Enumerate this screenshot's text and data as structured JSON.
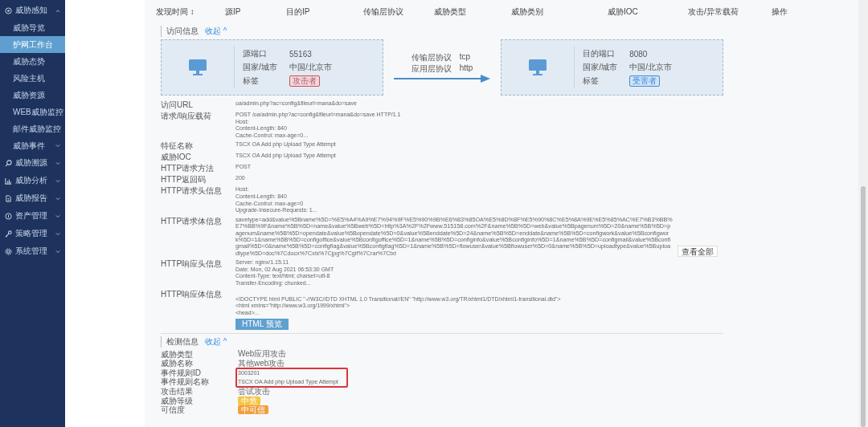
{
  "sidebar": {
    "items": [
      {
        "label": "威胁感知",
        "expanded": true,
        "children": [
          {
            "label": "威胁导览",
            "selected": false
          },
          {
            "label": "护网工作台",
            "selected": true
          },
          {
            "label": "威胁态势",
            "selected": false
          },
          {
            "label": "风险主机",
            "selected": false
          },
          {
            "label": "威胁资源",
            "selected": false
          },
          {
            "label": "WEB威胁监控",
            "selected": false
          },
          {
            "label": "邮件威胁监控",
            "selected": false
          },
          {
            "label": "威胁事件",
            "selected": false,
            "expanded": false
          }
        ]
      },
      {
        "label": "威胁溯源",
        "expanded": false
      },
      {
        "label": "威胁分析",
        "expanded": false
      },
      {
        "label": "威胁报告",
        "expanded": false
      },
      {
        "label": "资产管理",
        "expanded": false
      },
      {
        "label": "策略管理",
        "expanded": false
      },
      {
        "label": "系统管理",
        "expanded": false
      }
    ]
  },
  "table": {
    "columns": [
      "发现时间 ↕",
      "源IP",
      "目的IP",
      "传输层协议",
      "威胁类型",
      "威胁类别",
      "威胁IOC",
      "攻击/异常载荷",
      "操作"
    ]
  },
  "access_info": {
    "title": "访问信息",
    "toggle": "收起 ^",
    "source": {
      "fields": [
        {
          "label": "源端口",
          "value": "55163"
        },
        {
          "label": "国家/城市",
          "value": "中国/北京市"
        }
      ],
      "tag_label": "标签",
      "tag": {
        "text": "攻击者",
        "color": "#e0484a"
      }
    },
    "protocols": [
      {
        "label": "传输层协议",
        "value": "tcp"
      },
      {
        "label": "应用层协议",
        "value": "http"
      }
    ],
    "destination": {
      "fields": [
        {
          "label": "目的端口",
          "value": "8080"
        },
        {
          "label": "国家/城市",
          "value": "中国/北京市"
        }
      ],
      "tag_label": "标签",
      "tag": {
        "text": "受害者",
        "color": "#3a8ee6"
      }
    },
    "rows": [
      {
        "kind": "text",
        "label": "访问URL",
        "lines": [
          "oa/admin.php?ac=config&fileurl=mana&do=save"
        ]
      },
      {
        "kind": "text",
        "label": "请求/响应载荷",
        "lines": [
          "POST /oa/admin.php?ac=config&fileurl=mana&do=save HTTP/1.1",
          "Host:",
          "Content-Length: 840",
          "Cache-Control: max-age=0..."
        ]
      },
      {
        "kind": "text",
        "label": "特征名称",
        "lines": [
          "TSCX OA Add php Upload Type Attempt"
        ]
      },
      {
        "kind": "text",
        "label": "威胁IOC",
        "lines": [
          "TSCX OA Add php Upload Type Attempt"
        ]
      },
      {
        "kind": "text",
        "label": "HTTP请求方法",
        "lines": [
          "POST"
        ]
      },
      {
        "kind": "text",
        "label": "HTTP返回码",
        "lines": [
          "200"
        ]
      },
      {
        "kind": "text",
        "label": "HTTP请求头信息",
        "lines": [
          "Host:",
          "Content-Length: 840",
          "Cache-Control: max-age=0",
          "Upgrade-Insecure-Requests: 1..."
        ]
      },
      {
        "kind": "body",
        "label": "HTTP请求体信息",
        "lines": [
          "savetype=add&value%5Bname%5D=%E5%A4%A9%E7%94%9F%E5%90%9B%E6%83%85OA%E5%8D%8F%E5%90%8C%E5%8A%9E%E5%85%AC%E7%B3%BB%E7%BB%9F&name%5B%5D=name&value%5Bweb%5D=http%3A%2F%2Fwww.515158.com%2F&name%5B%5D=web&value%5Bpagenum%5D=20&name%5B%5D=pagenum&name%5B%5D=opendate&value%5Bopendate%5D=0&value%5Benddate%5D=24&name%5B%5D=enddate&name%5B%5D=configwork&value%5Bconfigwork%5D=1&name%5B%5D=configoffice&value%5Bconfigoffice%5D=1&name%5B%5D=configinfo&value%5Bconfiginfo%5D=1&name%5B%5D=configmail&value%5Bconfigmail%5D=0&name%5B%5D=configflag&value%5Bconfigflag%5D=1&name%5B%5D=flowuser&value%5Bflowuser%5D=0&name%5B%5D=uploadtype&value%5Buploadtype%5D=doc%7Cdocx%7Cxls%7Cjpg%7Cgif%7Crar%7Ctxt"
        ],
        "button": "查看全部"
      },
      {
        "kind": "text",
        "label": "HTTP响应头信息",
        "lines": [
          "Server: nginx/1.15.11",
          "Date: Mon, 02 Aug 2021 06:53:30 GMT",
          "Content-Type: text/html; charset=utf-8",
          "Transfer-Encoding: chunked..."
        ]
      },
      {
        "kind": "html",
        "label": "HTTP响应体信息",
        "lines": [
          "<!DOCTYPE html PUBLIC \"-//W3C//DTD XHTML 1.0 Transitional//EN\" \"http://www.w3.org/TR/xhtml1/DTD/xhtml1-transitional.dtd\">",
          "<html xmlns=\"http://www.w3.org/1999/xhtml\">",
          "<head>..."
        ],
        "button": "HTML 预览"
      }
    ]
  },
  "detection_info": {
    "title": "检测信息",
    "toggle": "收起 ^",
    "rows": [
      {
        "label": "威胁类型",
        "value": "Web应用攻击",
        "highlighted": false
      },
      {
        "label": "威胁名称",
        "value": "其他web攻击",
        "highlighted": false
      },
      {
        "label": "事件规则ID",
        "value": "3003201",
        "highlighted": true
      },
      {
        "label": "事件规则名称",
        "value": "TSCX OA Add php Upload Type Attempt",
        "highlighted": true
      },
      {
        "label": "攻击结果",
        "value": "尝试攻击",
        "highlighted": false
      },
      {
        "label": "威胁等级",
        "tag": {
          "text": "中危",
          "color": "#f5c542"
        },
        "highlighted": false
      },
      {
        "label": "可信度",
        "tag": {
          "text": "中可信",
          "color": "#f0a040"
        },
        "highlighted": false
      }
    ]
  }
}
